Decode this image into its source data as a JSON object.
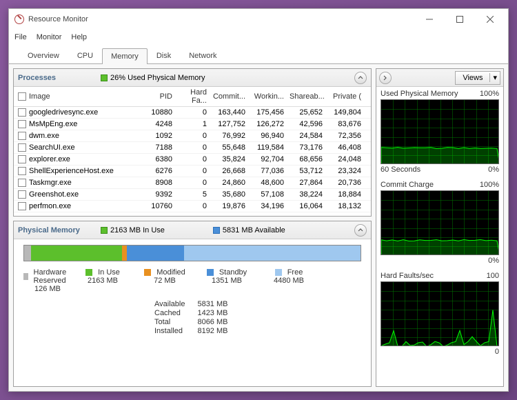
{
  "window": {
    "title": "Resource Monitor"
  },
  "menu": [
    "File",
    "Monitor",
    "Help"
  ],
  "tabs": [
    "Overview",
    "CPU",
    "Memory",
    "Disk",
    "Network"
  ],
  "active_tab": "Memory",
  "processes": {
    "title": "Processes",
    "summary": "26% Used Physical Memory",
    "summary_color": "#5cbf2c",
    "columns": [
      "Image",
      "PID",
      "Hard Fa...",
      "Commit...",
      "Workin...",
      "Shareab...",
      "Private ("
    ],
    "rows": [
      {
        "image": "googledrivesync.exe",
        "pid": 10880,
        "hf": 0,
        "commit": "163,440",
        "working": "175,456",
        "share": "25,652",
        "priv": "149,804"
      },
      {
        "image": "MsMpEng.exe",
        "pid": 4248,
        "hf": 1,
        "commit": "127,752",
        "working": "126,272",
        "share": "42,596",
        "priv": "83,676"
      },
      {
        "image": "dwm.exe",
        "pid": 1092,
        "hf": 0,
        "commit": "76,992",
        "working": "96,940",
        "share": "24,584",
        "priv": "72,356"
      },
      {
        "image": "SearchUI.exe",
        "pid": 7188,
        "hf": 0,
        "commit": "55,648",
        "working": "119,584",
        "share": "73,176",
        "priv": "46,408"
      },
      {
        "image": "explorer.exe",
        "pid": 6380,
        "hf": 0,
        "commit": "35,824",
        "working": "92,704",
        "share": "68,656",
        "priv": "24,048"
      },
      {
        "image": "ShellExperienceHost.exe",
        "pid": 6276,
        "hf": 0,
        "commit": "26,668",
        "working": "77,036",
        "share": "53,712",
        "priv": "23,324"
      },
      {
        "image": "Taskmgr.exe",
        "pid": 8908,
        "hf": 0,
        "commit": "24,860",
        "working": "48,600",
        "share": "27,864",
        "priv": "20,736"
      },
      {
        "image": "Greenshot.exe",
        "pid": 9392,
        "hf": 5,
        "commit": "35,680",
        "working": "57,108",
        "share": "38,224",
        "priv": "18,884"
      },
      {
        "image": "perfmon.exe",
        "pid": 10760,
        "hf": 0,
        "commit": "19,876",
        "working": "34,196",
        "share": "16,064",
        "priv": "18,132"
      }
    ]
  },
  "physical_memory": {
    "title": "Physical Memory",
    "in_use_label": "2163 MB In Use",
    "in_use_color": "#5cbf2c",
    "available_label": "5831 MB Available",
    "available_color": "#4a8fd8",
    "bar": [
      {
        "name": "Hardware Reserved",
        "value": "126 MB",
        "color": "#b8b8b8",
        "pct": 2
      },
      {
        "name": "In Use",
        "value": "2163 MB",
        "color": "#5cbf2c",
        "pct": 27
      },
      {
        "name": "Modified",
        "value": "72 MB",
        "color": "#e89020",
        "pct": 1.5
      },
      {
        "name": "Standby",
        "value": "1351 MB",
        "color": "#4a8fd8",
        "pct": 17
      },
      {
        "name": "Free",
        "value": "4480 MB",
        "color": "#9fc8ef",
        "pct": 52.5
      }
    ],
    "stats": [
      {
        "label": "Available",
        "value": "5831 MB"
      },
      {
        "label": "Cached",
        "value": "1423 MB"
      },
      {
        "label": "Total",
        "value": "8066 MB"
      },
      {
        "label": "Installed",
        "value": "8192 MB"
      }
    ]
  },
  "right_panel": {
    "views_label": "Views",
    "charts": [
      {
        "title": "Used Physical Memory",
        "max": "100%",
        "footer_left": "60 Seconds",
        "footer_right": "0%",
        "type": "flat",
        "level": 0.26
      },
      {
        "title": "Commit Charge",
        "max": "100%",
        "footer_left": "",
        "footer_right": "0%",
        "type": "flat",
        "level": 0.24
      },
      {
        "title": "Hard Faults/sec",
        "max": "100",
        "footer_left": "",
        "footer_right": "0",
        "type": "spiky"
      }
    ]
  },
  "chart_data": {
    "type": "table",
    "title": "Process Memory Usage",
    "columns": [
      "Image",
      "PID",
      "Hard Faults",
      "Commit (KB)",
      "Working Set (KB)",
      "Shareable (KB)",
      "Private (KB)"
    ],
    "rows": [
      [
        "googledrivesync.exe",
        10880,
        0,
        163440,
        175456,
        25652,
        149804
      ],
      [
        "MsMpEng.exe",
        4248,
        1,
        127752,
        126272,
        42596,
        83676
      ],
      [
        "dwm.exe",
        1092,
        0,
        76992,
        96940,
        24584,
        72356
      ],
      [
        "SearchUI.exe",
        7188,
        0,
        55648,
        119584,
        73176,
        46408
      ],
      [
        "explorer.exe",
        6380,
        0,
        35824,
        92704,
        68656,
        24048
      ],
      [
        "ShellExperienceHost.exe",
        6276,
        0,
        26668,
        77036,
        53712,
        23324
      ],
      [
        "Taskmgr.exe",
        8908,
        0,
        24860,
        48600,
        27864,
        20736
      ],
      [
        "Greenshot.exe",
        9392,
        5,
        35680,
        57108,
        38224,
        18884
      ],
      [
        "perfmon.exe",
        10760,
        0,
        19876,
        34196,
        16064,
        18132
      ]
    ]
  }
}
